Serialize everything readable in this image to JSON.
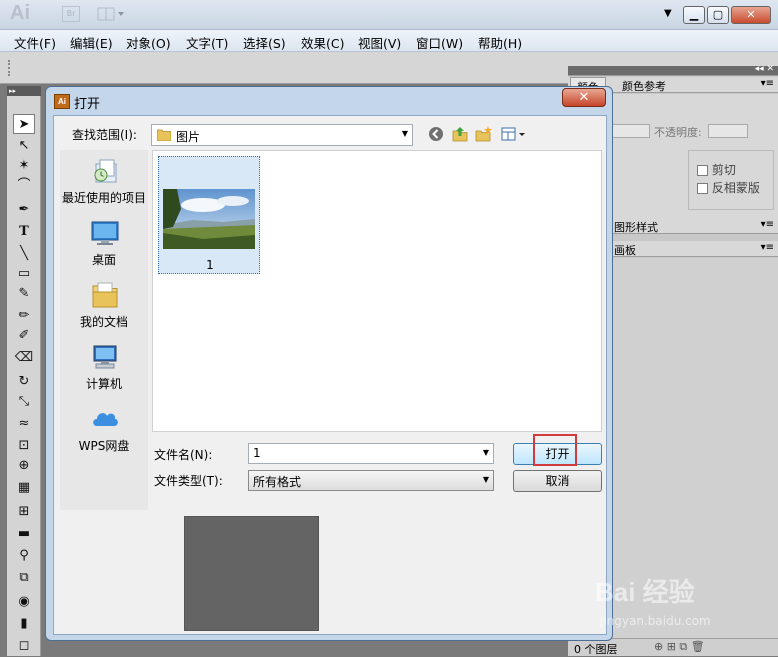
{
  "app": {
    "logo": "Ai",
    "bridge_label": "Br",
    "menu": [
      "文件(F)",
      "编辑(E)",
      "对象(O)",
      "文字(T)",
      "选择(S)",
      "效果(C)",
      "视图(V)",
      "窗口(W)",
      "帮助(H)"
    ]
  },
  "panels": {
    "top_tabs": [
      "颜色",
      "颜色参考"
    ],
    "opacity_label": "不透明度:",
    "clip_label": "剪切",
    "invert_mask_label": "反相蒙版",
    "graphic_styles_tab": "图形样式",
    "swatches_tab": "画板",
    "layer_count": "0 个图层"
  },
  "dialog": {
    "title": "打开",
    "close_symbol": "✕",
    "lookin_label": "查找范围(I):",
    "lookin_value": "图片",
    "places": [
      {
        "label": "最近使用的项目",
        "icon": "recent-items-icon"
      },
      {
        "label": "桌面",
        "icon": "desktop-icon"
      },
      {
        "label": "我的文档",
        "icon": "documents-icon"
      },
      {
        "label": "计算机",
        "icon": "computer-icon"
      },
      {
        "label": "WPS网盘",
        "icon": "cloud-icon"
      }
    ],
    "file_item_label": "1",
    "filename_label": "文件名(N):",
    "filename_value": "1",
    "filetype_label": "文件类型(T):",
    "filetype_value": "所有格式",
    "open_button": "打开",
    "cancel_button": "取消"
  },
  "watermark": {
    "brand": "Bai 经验",
    "url": "jingyan.baidu.com"
  },
  "colors": {
    "highlight": "#d23b3b",
    "dialog_frame": "#c3d6ea"
  }
}
